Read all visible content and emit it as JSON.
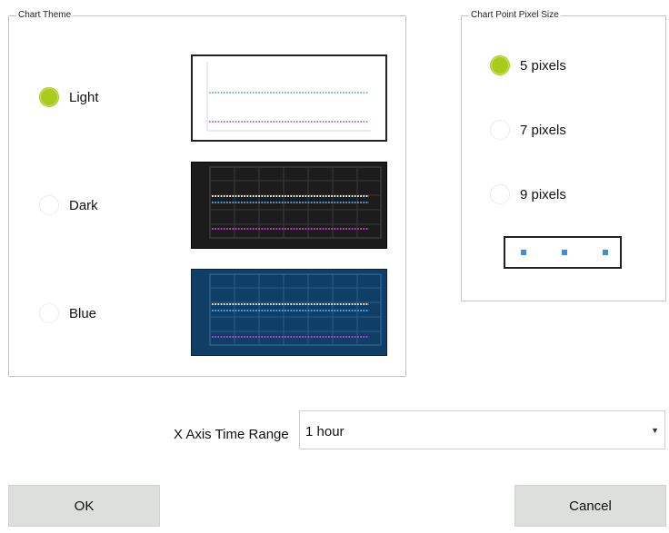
{
  "chart_theme": {
    "title": "Chart Theme",
    "options": [
      {
        "label": "Light",
        "selected": true
      },
      {
        "label": "Dark",
        "selected": false
      },
      {
        "label": "Blue",
        "selected": false
      }
    ]
  },
  "point_size": {
    "title": "Chart Point Pixel Size",
    "options": [
      {
        "label": "5 pixels",
        "selected": true
      },
      {
        "label": "7 pixels",
        "selected": false
      },
      {
        "label": "9 pixels",
        "selected": false
      }
    ]
  },
  "x_axis": {
    "label": "X Axis Time Range",
    "value": "1 hour"
  },
  "buttons": {
    "ok": "OK",
    "cancel": "Cancel"
  },
  "colors": {
    "accent": "#a9cc1c",
    "dark_bg": "#1c1c1c",
    "blue_bg": "#0f3f67",
    "series_white": "#e6e6e6",
    "series_blue": "#4aa0e6",
    "series_magenta": "#cc33cc",
    "point": "#3d8ddf"
  }
}
